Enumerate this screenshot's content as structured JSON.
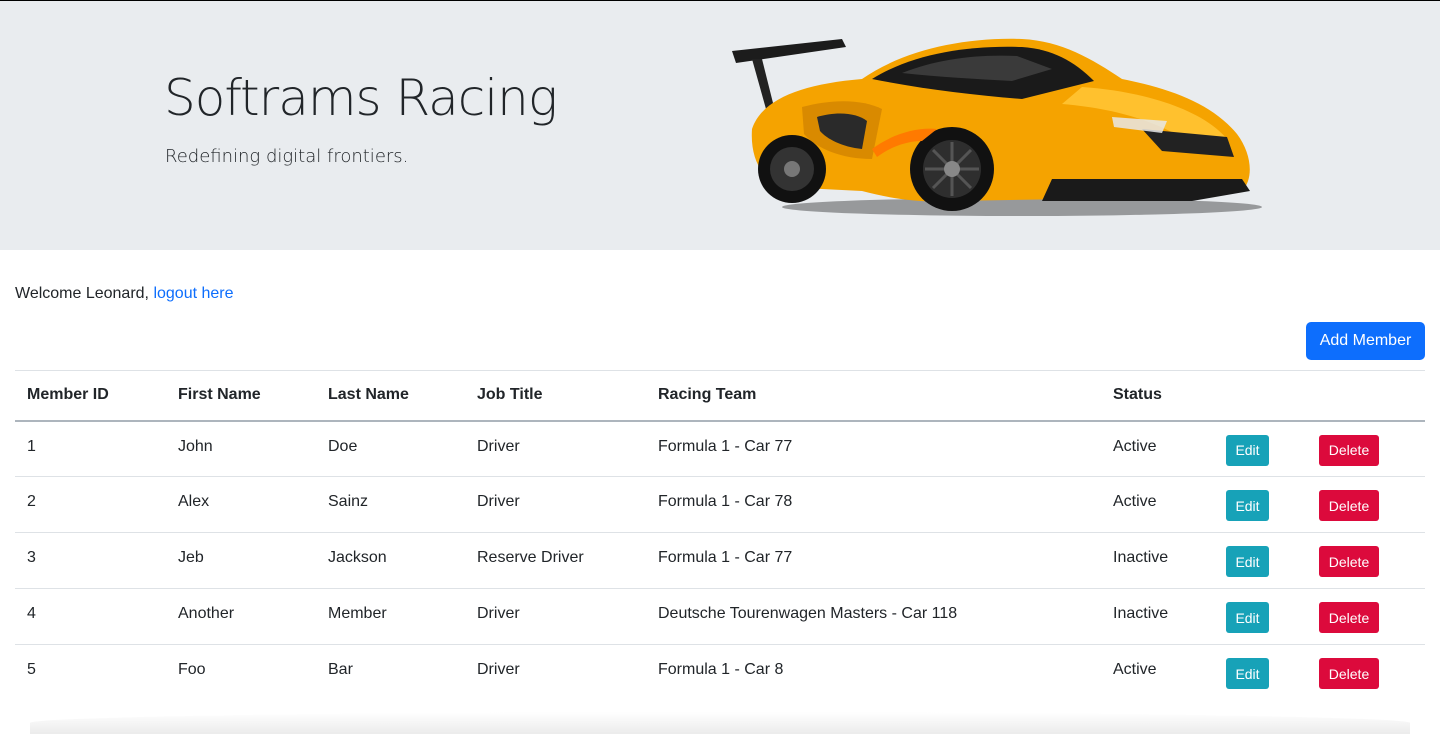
{
  "hero": {
    "title": "Softrams Racing",
    "subtitle": "Redefining digital frontiers.",
    "image": "yellow-race-car-image"
  },
  "welcome": {
    "text": "Welcome Leonard,",
    "logout_link": "logout here"
  },
  "actions": {
    "add_member": "Add Member"
  },
  "table": {
    "headers": [
      "Member ID",
      "First Name",
      "Last Name",
      "Job Title",
      "Racing Team",
      "Status",
      "",
      ""
    ],
    "edit_label": "Edit",
    "delete_label": "Delete",
    "rows": [
      {
        "id": "1",
        "first": "John",
        "last": "Doe",
        "job": "Driver",
        "team": "Formula 1 - Car 77",
        "status": "Active"
      },
      {
        "id": "2",
        "first": "Alex",
        "last": "Sainz",
        "job": "Driver",
        "team": "Formula 1 - Car 78",
        "status": "Active"
      },
      {
        "id": "3",
        "first": "Jeb",
        "last": "Jackson",
        "job": "Reserve Driver",
        "team": "Formula 1 - Car 77",
        "status": "Inactive"
      },
      {
        "id": "4",
        "first": "Another",
        "last": "Member",
        "job": "Driver",
        "team": "Deutsche Tourenwagen Masters - Car 118",
        "status": "Inactive"
      },
      {
        "id": "5",
        "first": "Foo",
        "last": "Bar",
        "job": "Driver",
        "team": "Formula 1 - Car 8",
        "status": "Active"
      }
    ]
  },
  "colors": {
    "hero_bg": "#e9ecef",
    "primary": "#0d6efd",
    "edit": "#17a2b8",
    "delete": "#dc0a3c"
  }
}
